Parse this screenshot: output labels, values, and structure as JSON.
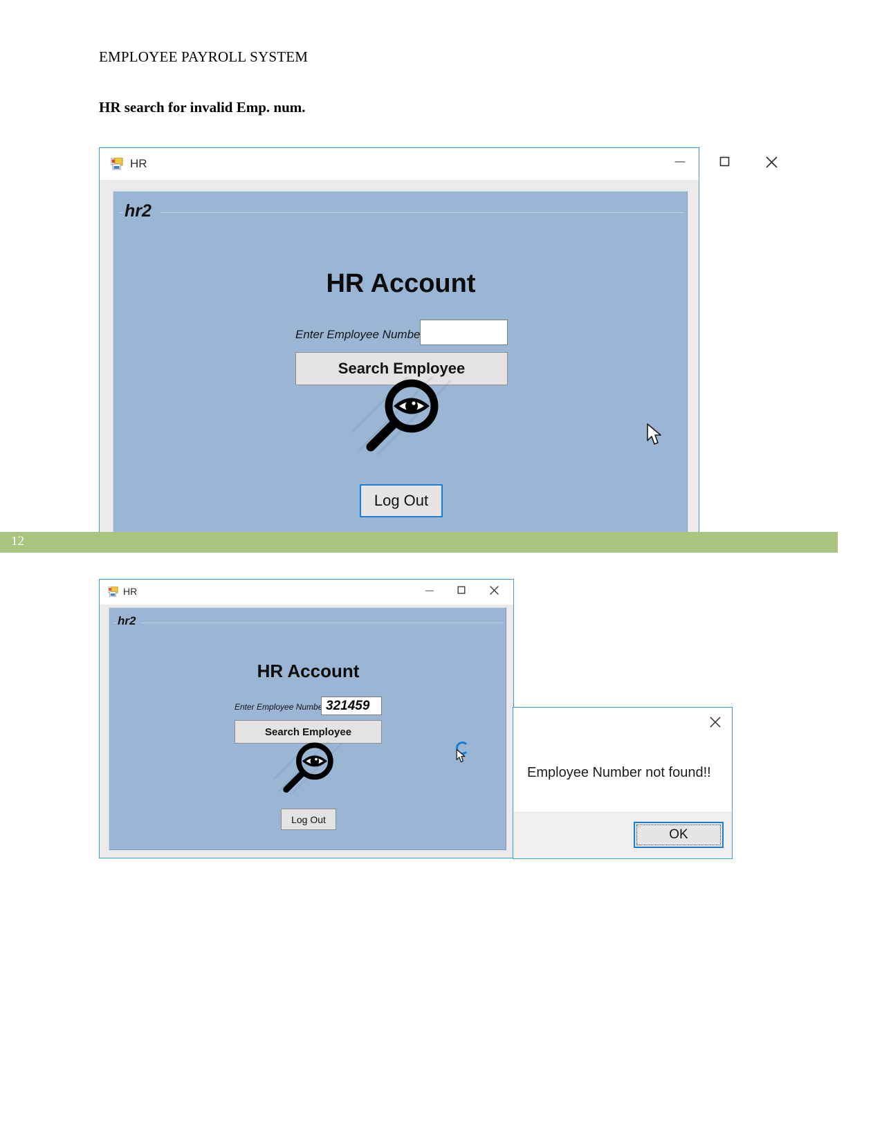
{
  "document": {
    "title": "EMPLOYEE PAYROLL SYSTEM",
    "subtitle": "HR search for invalid Emp. num.",
    "page_number": "12",
    "band_color": "#a9c47f"
  },
  "window_top": {
    "title": "HR",
    "icon": "winforms-app-icon",
    "controls": {
      "minimize": "—",
      "maximize": "☐",
      "close": "✕"
    },
    "form": {
      "panel_label": "hr2",
      "heading": "HR Account",
      "field_label": "Enter Employee Number",
      "field_value": "",
      "field_placeholder": "",
      "search_button": "Search Employee",
      "logout_button": "Log Out",
      "picture_icon": "magnifier-eye-icon",
      "panel_color": "#9ab6d4"
    }
  },
  "window_bottom": {
    "title": "HR",
    "icon": "winforms-app-icon",
    "controls": {
      "minimize": "—",
      "maximize": "☐",
      "close": "✕"
    },
    "form": {
      "panel_label": "hr2",
      "heading": "HR Account",
      "field_label": "Enter Employee Number",
      "field_value": "321459",
      "field_placeholder": "",
      "search_button": "Search Employee",
      "logout_button": "Log Out",
      "picture_icon": "magnifier-eye-icon",
      "panel_color": "#9ab6d4"
    }
  },
  "dialog": {
    "message": "Employee Number not found!!",
    "ok_button": "OK",
    "close_icon": "✕",
    "accent_color": "#1a7fd4"
  }
}
